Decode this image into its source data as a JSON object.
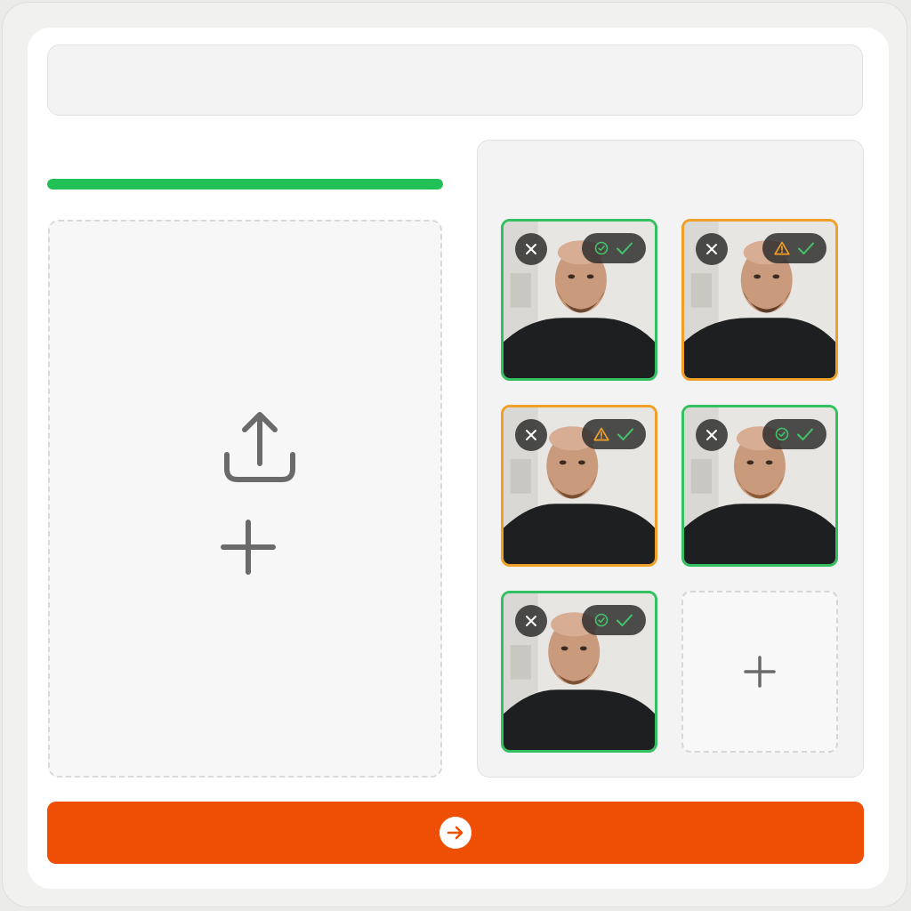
{
  "upload": {
    "progress_percent": 100,
    "upload_icon": "upload-tray-icon",
    "add_icon": "plus-icon"
  },
  "photos": [
    {
      "status": "ok",
      "status_icon": "check-circle-icon",
      "confirm_icon": "checkmark-icon",
      "remove_icon": "close-icon"
    },
    {
      "status": "warning",
      "status_icon": "warning-triangle-icon",
      "confirm_icon": "checkmark-icon",
      "remove_icon": "close-icon"
    },
    {
      "status": "warning",
      "status_icon": "warning-triangle-icon",
      "confirm_icon": "checkmark-icon",
      "remove_icon": "close-icon"
    },
    {
      "status": "ok",
      "status_icon": "check-circle-icon",
      "confirm_icon": "checkmark-icon",
      "remove_icon": "close-icon"
    },
    {
      "status": "ok",
      "status_icon": "check-circle-icon",
      "confirm_icon": "checkmark-icon",
      "remove_icon": "close-icon"
    }
  ],
  "add_slot": {
    "icon": "plus-icon"
  },
  "submit": {
    "icon": "arrow-right-icon"
  },
  "colors": {
    "ok": "#33c060",
    "warning": "#f0a028",
    "progress": "#22c158",
    "submit": "#ee4f05"
  }
}
